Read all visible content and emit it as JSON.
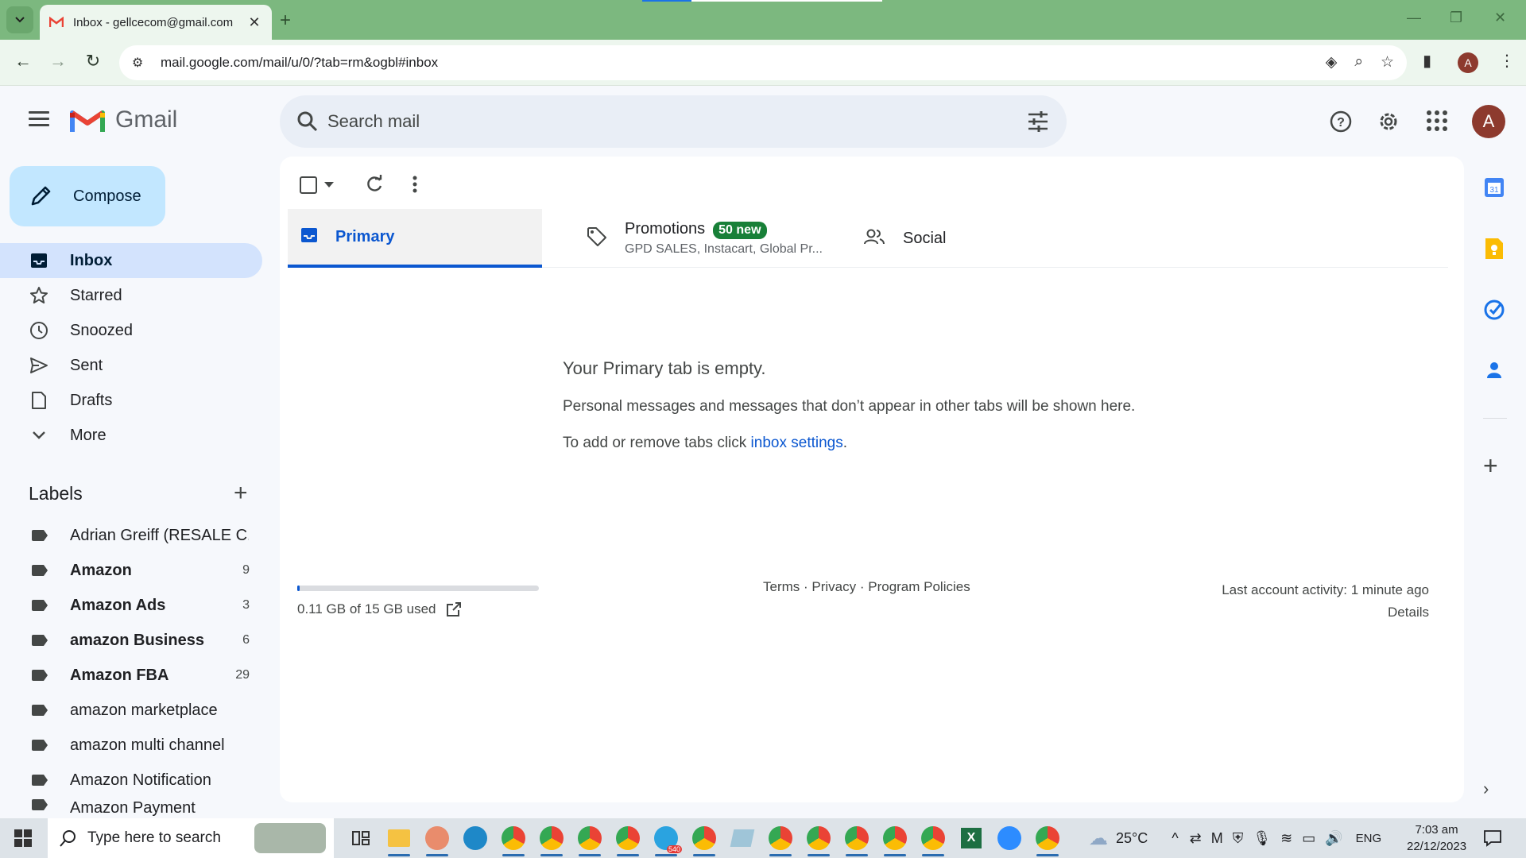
{
  "browser": {
    "tab_title": "Inbox - gellcecom@gmail.com",
    "url": "mail.google.com/mail/u/0/?tab=rm&ogbl#inbox",
    "profile_initial": "A",
    "theme_color": "#7cb87f"
  },
  "gmail": {
    "brand": "Gmail",
    "search_placeholder": "Search mail",
    "avatar_initial": "A"
  },
  "sidebar": {
    "compose_label": "Compose",
    "items": [
      {
        "label": "Inbox",
        "icon": "inbox-icon",
        "active": true
      },
      {
        "label": "Starred",
        "icon": "star-icon"
      },
      {
        "label": "Snoozed",
        "icon": "clock-icon"
      },
      {
        "label": "Sent",
        "icon": "send-icon"
      },
      {
        "label": "Drafts",
        "icon": "draft-icon"
      },
      {
        "label": "More",
        "icon": "chevron-down-icon"
      }
    ],
    "labels_heading": "Labels",
    "labels": [
      {
        "name": "Adrian Greiff (RESALE C...",
        "count": "",
        "bold": false
      },
      {
        "name": "Amazon",
        "count": "9",
        "bold": true
      },
      {
        "name": "Amazon Ads",
        "count": "3",
        "bold": true
      },
      {
        "name": "amazon Business",
        "count": "6",
        "bold": true
      },
      {
        "name": "Amazon FBA",
        "count": "29",
        "bold": true
      },
      {
        "name": "amazon marketplace",
        "count": "",
        "bold": false
      },
      {
        "name": "amazon multi channel",
        "count": "",
        "bold": false
      },
      {
        "name": "Amazon Notification",
        "count": "",
        "bold": false
      },
      {
        "name": "Amazon Payment",
        "count": "",
        "bold": false
      }
    ]
  },
  "main": {
    "tabs": {
      "primary": "Primary",
      "promotions": "Promotions",
      "promotions_badge": "50 new",
      "promotions_sub": "GPD SALES, Instacart, Global Pr...",
      "social": "Social"
    },
    "empty": {
      "heading": "Your Primary tab is empty.",
      "line1": "Personal messages and messages that don’t appear in other tabs will be shown here.",
      "line2_prefix": "To add or remove tabs click ",
      "line2_link": "inbox settings",
      "line2_suffix": "."
    },
    "footer": {
      "storage": "0.11 GB of 15 GB used",
      "storage_fraction": 0.0073,
      "terms": "Terms",
      "privacy": "Privacy",
      "policies": "Program Policies",
      "sep": " · ",
      "activity": "Last account activity: 1 minute ago",
      "details": "Details"
    }
  },
  "taskbar": {
    "search_placeholder": "Type here to search",
    "weather": "25°C",
    "lang": "ENG",
    "time": "7:03 am",
    "date": "22/12/2023",
    "telegram_badge": "540"
  }
}
